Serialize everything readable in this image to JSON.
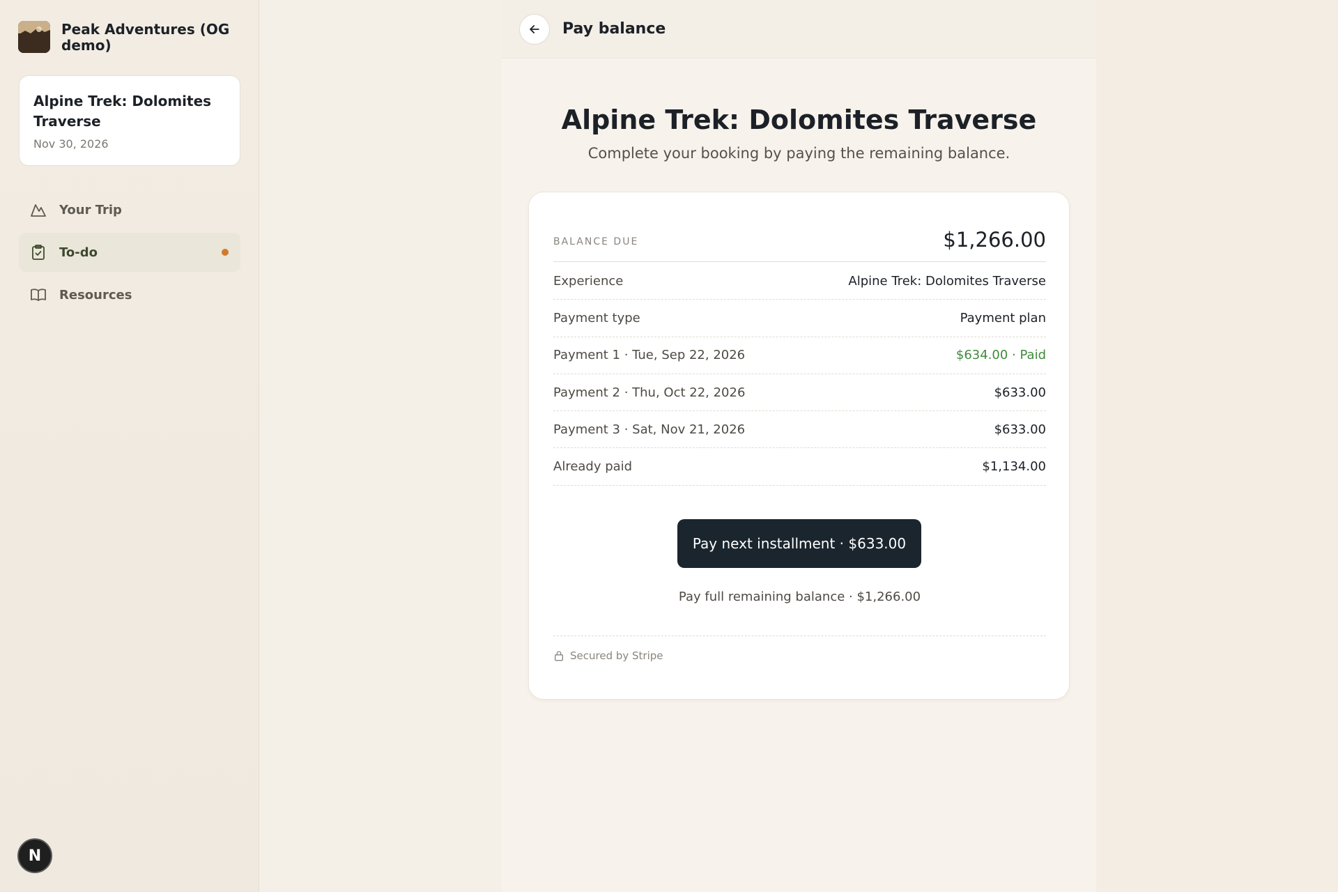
{
  "sidebar": {
    "brand_name": "Peak Adventures (OG demo)",
    "trip": {
      "title": "Alpine Trek: Dolomites Traverse",
      "date": "Nov 30, 2026"
    },
    "nav": [
      {
        "label": "Your Trip",
        "icon": "mountain-icon",
        "active": false
      },
      {
        "label": "To-do",
        "icon": "clipboard-check-icon",
        "active": true,
        "has_dot": true
      },
      {
        "label": "Resources",
        "icon": "book-open-icon",
        "active": false
      }
    ],
    "user_badge": "N"
  },
  "header": {
    "back_icon": "arrow-left-icon",
    "title": "Pay balance"
  },
  "main": {
    "heading": "Alpine Trek: Dolomites Traverse",
    "subheading": "Complete your booking by paying the remaining balance.",
    "card": {
      "balance_label": "BALANCE DUE",
      "balance_amount": "$1,266.00",
      "rows": [
        {
          "label": "Experience",
          "value": "Alpine Trek: Dolomites Traverse"
        },
        {
          "label": "Payment type",
          "value": "Payment plan"
        },
        {
          "label": "Payment 1 · Tue, Sep 22, 2026",
          "value": "$634.00 · Paid",
          "status": "paid"
        },
        {
          "label": "Payment 2 · Thu, Oct 22, 2026",
          "value": "$633.00"
        },
        {
          "label": "Payment 3 · Sat, Nov 21, 2026",
          "value": "$633.00"
        },
        {
          "label": "Already paid",
          "value": "$1,134.00"
        }
      ],
      "pay_next_label": "Pay next installment · $633.00",
      "pay_full_label": "Pay full remaining balance · $1,266.00",
      "secure_label": "Secured by Stripe"
    }
  },
  "colors": {
    "accent_dark": "#1b252d",
    "paid_green": "#3f8a3c",
    "notification_dot": "#d27a2c"
  }
}
